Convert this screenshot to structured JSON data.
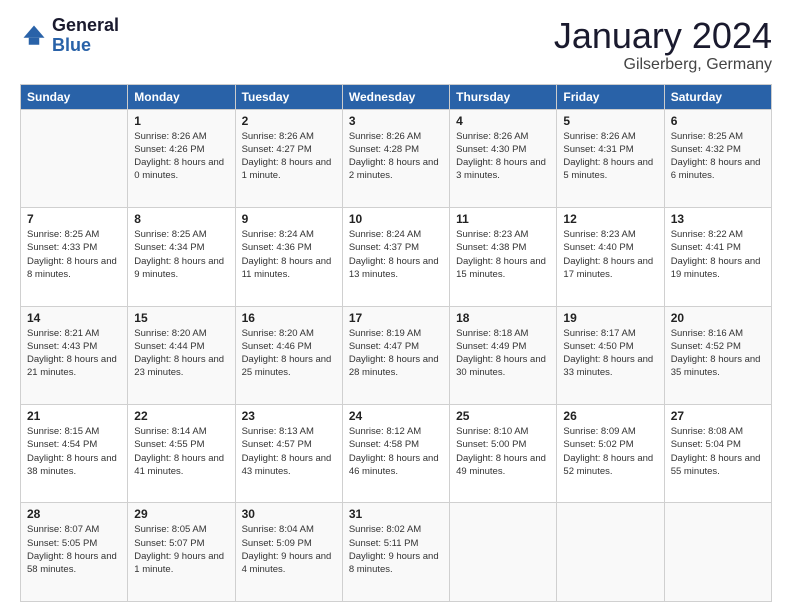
{
  "header": {
    "logo": {
      "general": "General",
      "blue": "Blue"
    },
    "title": "January 2024",
    "location": "Gilserberg, Germany"
  },
  "weekdays": [
    "Sunday",
    "Monday",
    "Tuesday",
    "Wednesday",
    "Thursday",
    "Friday",
    "Saturday"
  ],
  "weeks": [
    [
      {
        "day": "",
        "sunrise": "",
        "sunset": "",
        "daylight": ""
      },
      {
        "day": "1",
        "sunrise": "Sunrise: 8:26 AM",
        "sunset": "Sunset: 4:26 PM",
        "daylight": "Daylight: 8 hours and 0 minutes."
      },
      {
        "day": "2",
        "sunrise": "Sunrise: 8:26 AM",
        "sunset": "Sunset: 4:27 PM",
        "daylight": "Daylight: 8 hours and 1 minute."
      },
      {
        "day": "3",
        "sunrise": "Sunrise: 8:26 AM",
        "sunset": "Sunset: 4:28 PM",
        "daylight": "Daylight: 8 hours and 2 minutes."
      },
      {
        "day": "4",
        "sunrise": "Sunrise: 8:26 AM",
        "sunset": "Sunset: 4:30 PM",
        "daylight": "Daylight: 8 hours and 3 minutes."
      },
      {
        "day": "5",
        "sunrise": "Sunrise: 8:26 AM",
        "sunset": "Sunset: 4:31 PM",
        "daylight": "Daylight: 8 hours and 5 minutes."
      },
      {
        "day": "6",
        "sunrise": "Sunrise: 8:25 AM",
        "sunset": "Sunset: 4:32 PM",
        "daylight": "Daylight: 8 hours and 6 minutes."
      }
    ],
    [
      {
        "day": "7",
        "sunrise": "Sunrise: 8:25 AM",
        "sunset": "Sunset: 4:33 PM",
        "daylight": "Daylight: 8 hours and 8 minutes."
      },
      {
        "day": "8",
        "sunrise": "Sunrise: 8:25 AM",
        "sunset": "Sunset: 4:34 PM",
        "daylight": "Daylight: 8 hours and 9 minutes."
      },
      {
        "day": "9",
        "sunrise": "Sunrise: 8:24 AM",
        "sunset": "Sunset: 4:36 PM",
        "daylight": "Daylight: 8 hours and 11 minutes."
      },
      {
        "day": "10",
        "sunrise": "Sunrise: 8:24 AM",
        "sunset": "Sunset: 4:37 PM",
        "daylight": "Daylight: 8 hours and 13 minutes."
      },
      {
        "day": "11",
        "sunrise": "Sunrise: 8:23 AM",
        "sunset": "Sunset: 4:38 PM",
        "daylight": "Daylight: 8 hours and 15 minutes."
      },
      {
        "day": "12",
        "sunrise": "Sunrise: 8:23 AM",
        "sunset": "Sunset: 4:40 PM",
        "daylight": "Daylight: 8 hours and 17 minutes."
      },
      {
        "day": "13",
        "sunrise": "Sunrise: 8:22 AM",
        "sunset": "Sunset: 4:41 PM",
        "daylight": "Daylight: 8 hours and 19 minutes."
      }
    ],
    [
      {
        "day": "14",
        "sunrise": "Sunrise: 8:21 AM",
        "sunset": "Sunset: 4:43 PM",
        "daylight": "Daylight: 8 hours and 21 minutes."
      },
      {
        "day": "15",
        "sunrise": "Sunrise: 8:20 AM",
        "sunset": "Sunset: 4:44 PM",
        "daylight": "Daylight: 8 hours and 23 minutes."
      },
      {
        "day": "16",
        "sunrise": "Sunrise: 8:20 AM",
        "sunset": "Sunset: 4:46 PM",
        "daylight": "Daylight: 8 hours and 25 minutes."
      },
      {
        "day": "17",
        "sunrise": "Sunrise: 8:19 AM",
        "sunset": "Sunset: 4:47 PM",
        "daylight": "Daylight: 8 hours and 28 minutes."
      },
      {
        "day": "18",
        "sunrise": "Sunrise: 8:18 AM",
        "sunset": "Sunset: 4:49 PM",
        "daylight": "Daylight: 8 hours and 30 minutes."
      },
      {
        "day": "19",
        "sunrise": "Sunrise: 8:17 AM",
        "sunset": "Sunset: 4:50 PM",
        "daylight": "Daylight: 8 hours and 33 minutes."
      },
      {
        "day": "20",
        "sunrise": "Sunrise: 8:16 AM",
        "sunset": "Sunset: 4:52 PM",
        "daylight": "Daylight: 8 hours and 35 minutes."
      }
    ],
    [
      {
        "day": "21",
        "sunrise": "Sunrise: 8:15 AM",
        "sunset": "Sunset: 4:54 PM",
        "daylight": "Daylight: 8 hours and 38 minutes."
      },
      {
        "day": "22",
        "sunrise": "Sunrise: 8:14 AM",
        "sunset": "Sunset: 4:55 PM",
        "daylight": "Daylight: 8 hours and 41 minutes."
      },
      {
        "day": "23",
        "sunrise": "Sunrise: 8:13 AM",
        "sunset": "Sunset: 4:57 PM",
        "daylight": "Daylight: 8 hours and 43 minutes."
      },
      {
        "day": "24",
        "sunrise": "Sunrise: 8:12 AM",
        "sunset": "Sunset: 4:58 PM",
        "daylight": "Daylight: 8 hours and 46 minutes."
      },
      {
        "day": "25",
        "sunrise": "Sunrise: 8:10 AM",
        "sunset": "Sunset: 5:00 PM",
        "daylight": "Daylight: 8 hours and 49 minutes."
      },
      {
        "day": "26",
        "sunrise": "Sunrise: 8:09 AM",
        "sunset": "Sunset: 5:02 PM",
        "daylight": "Daylight: 8 hours and 52 minutes."
      },
      {
        "day": "27",
        "sunrise": "Sunrise: 8:08 AM",
        "sunset": "Sunset: 5:04 PM",
        "daylight": "Daylight: 8 hours and 55 minutes."
      }
    ],
    [
      {
        "day": "28",
        "sunrise": "Sunrise: 8:07 AM",
        "sunset": "Sunset: 5:05 PM",
        "daylight": "Daylight: 8 hours and 58 minutes."
      },
      {
        "day": "29",
        "sunrise": "Sunrise: 8:05 AM",
        "sunset": "Sunset: 5:07 PM",
        "daylight": "Daylight: 9 hours and 1 minute."
      },
      {
        "day": "30",
        "sunrise": "Sunrise: 8:04 AM",
        "sunset": "Sunset: 5:09 PM",
        "daylight": "Daylight: 9 hours and 4 minutes."
      },
      {
        "day": "31",
        "sunrise": "Sunrise: 8:02 AM",
        "sunset": "Sunset: 5:11 PM",
        "daylight": "Daylight: 9 hours and 8 minutes."
      },
      {
        "day": "",
        "sunrise": "",
        "sunset": "",
        "daylight": ""
      },
      {
        "day": "",
        "sunrise": "",
        "sunset": "",
        "daylight": ""
      },
      {
        "day": "",
        "sunrise": "",
        "sunset": "",
        "daylight": ""
      }
    ]
  ]
}
